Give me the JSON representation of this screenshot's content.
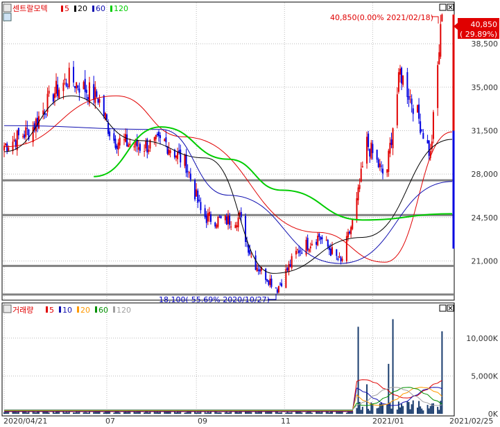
{
  "price_panel": {
    "title": "센트랄모텍",
    "legend": [
      {
        "label": "5",
        "color": "#e00000"
      },
      {
        "label": "20",
        "color": "#000000"
      },
      {
        "label": "60",
        "color": "#1010b0"
      },
      {
        "label": "120",
        "color": "#00cc00"
      }
    ],
    "high_annotation": "40,850(0.00% 2021/02/18)",
    "low_annotation": "18,100(-55.69% 2020/10/27)",
    "last_price_label": "40,850",
    "last_change_label": "( 29.89%)",
    "y_ticks": [
      "38,500",
      "35,000",
      "31,500",
      "28,000",
      "24,500",
      "21,000"
    ]
  },
  "volume_panel": {
    "title": "거래량",
    "legend": [
      {
        "label": "5",
        "color": "#e00000"
      },
      {
        "label": "10",
        "color": "#1010b0"
      },
      {
        "label": "20",
        "color": "#ff9900"
      },
      {
        "label": "60",
        "color": "#009000"
      },
      {
        "label": "120",
        "color": "#a0a0a0"
      }
    ],
    "y_ticks": [
      "10,000K",
      "5,000K",
      "0K"
    ]
  },
  "x_ticks": [
    "2020/04/21",
    "07",
    "09",
    "11",
    "2021/01",
    "2021/02/25"
  ],
  "colors": {
    "up": "#e00000",
    "down": "#0000e0",
    "hline": "#808080",
    "volume": "#1a3d6e"
  },
  "chart_data": {
    "type": "candlestick",
    "title": "센트랄모텍",
    "x_range": [
      "2020/04/21",
      "2021/02/25"
    ],
    "ylim_price": [
      18100,
      40850
    ],
    "ylim_volume_K": [
      0,
      13000
    ],
    "high": {
      "value": 40850,
      "label": "40,850(0.00% 2021/02/18)"
    },
    "low": {
      "value": 18100,
      "label": "18,100(-55.69% 2020/10/27)"
    },
    "horizontal_levels": [
      27500,
      24700,
      20600,
      18300
    ],
    "close_path": [
      {
        "x": "2020/04/21",
        "close": 30300
      },
      {
        "x": "2020/05/10",
        "close": 31600
      },
      {
        "x": "2020/05/25",
        "close": 34500
      },
      {
        "x": "2020/06/05",
        "close": 35700
      },
      {
        "x": "2020/06/25",
        "close": 34200
      },
      {
        "x": "2020/07/05",
        "close": 30800
      },
      {
        "x": "2020/07/25",
        "close": 30200
      },
      {
        "x": "2020/08/10",
        "close": 30600
      },
      {
        "x": "2020/08/25",
        "close": 28800
      },
      {
        "x": "2020/09/05",
        "close": 24600
      },
      {
        "x": "2020/09/20",
        "close": 24200
      },
      {
        "x": "2020/10/01",
        "close": 24500
      },
      {
        "x": "2020/10/10",
        "close": 21000
      },
      {
        "x": "2020/10/27",
        "close": 18800
      },
      {
        "x": "2020/11/10",
        "close": 21800
      },
      {
        "x": "2020/11/25",
        "close": 23000
      },
      {
        "x": "2020/12/10",
        "close": 20800
      },
      {
        "x": "2020/12/20",
        "close": 25000
      },
      {
        "x": "2020/12/28",
        "close": 30500
      },
      {
        "x": "2021/01/10",
        "close": 27600
      },
      {
        "x": "2021/01/20",
        "close": 36200
      },
      {
        "x": "2021/02/01",
        "close": 32800
      },
      {
        "x": "2021/02/10",
        "close": 29500
      },
      {
        "x": "2021/02/18",
        "close": 40850
      }
    ],
    "ma_series": [
      {
        "name": "5",
        "color": "#e00000",
        "points": [
          [
            0,
            30200
          ],
          [
            0.25,
            34300
          ],
          [
            0.4,
            31000
          ],
          [
            0.7,
            23300
          ],
          [
            0.85,
            20900
          ],
          [
            1,
            31400
          ]
        ]
      },
      {
        "name": "20",
        "color": "#000000",
        "points": [
          [
            0,
            29800
          ],
          [
            0.15,
            34300
          ],
          [
            0.3,
            30700
          ],
          [
            0.45,
            29300
          ],
          [
            0.6,
            20000
          ],
          [
            0.8,
            22900
          ],
          [
            1,
            30800
          ]
        ]
      },
      {
        "name": "60",
        "color": "#1010b0",
        "points": [
          [
            0,
            31900
          ],
          [
            0.35,
            31600
          ],
          [
            0.5,
            26300
          ],
          [
            0.75,
            20800
          ],
          [
            1,
            27400
          ]
        ]
      },
      {
        "name": "120",
        "color": "#00cc00",
        "points": [
          [
            0.2,
            27800
          ],
          [
            0.35,
            31800
          ],
          [
            0.5,
            29200
          ],
          [
            0.62,
            26700
          ],
          [
            0.8,
            24300
          ],
          [
            1,
            24800
          ]
        ]
      }
    ],
    "volume_spikes_K": [
      {
        "x": "2020/12/22",
        "value": 11500
      },
      {
        "x": "2020/12/28",
        "value": 3900
      },
      {
        "x": "2021/01/12",
        "value": 6600
      },
      {
        "x": "2021/01/15",
        "value": 12500
      },
      {
        "x": "2021/02/18",
        "value": 10900
      }
    ]
  }
}
